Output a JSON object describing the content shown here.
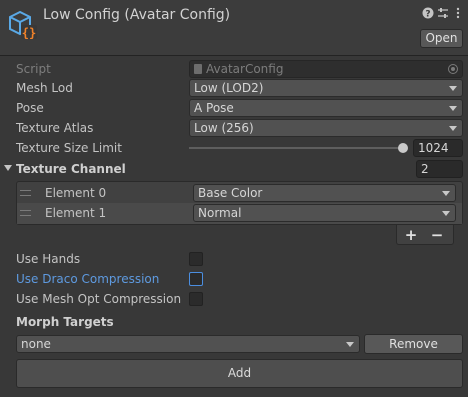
{
  "header": {
    "title": "Low Config (Avatar Config)",
    "help_icon": "help-icon",
    "settings_icon": "sliders-icon",
    "menu_icon": "kebab-menu-icon",
    "open_label": "Open"
  },
  "fields": {
    "script": {
      "label": "Script",
      "value": "AvatarConfig"
    },
    "mesh_lod": {
      "label": "Mesh Lod",
      "value": "Low (LOD2)"
    },
    "pose": {
      "label": "Pose",
      "value": "A Pose"
    },
    "texture_atlas": {
      "label": "Texture Atlas",
      "value": "Low (256)"
    },
    "texture_size_limit": {
      "label": "Texture Size Limit",
      "value": "1024"
    }
  },
  "texture_channel": {
    "label": "Texture Channel",
    "count": "2",
    "elements": [
      {
        "label": "Element 0",
        "value": "Base Color"
      },
      {
        "label": "Element 1",
        "value": "Normal"
      }
    ],
    "add_label": "+",
    "remove_label": "−"
  },
  "toggles": {
    "use_hands": {
      "label": "Use Hands",
      "checked": false
    },
    "use_draco": {
      "label": "Use Draco Compression",
      "checked": false
    },
    "use_mesh_opt": {
      "label": "Use Mesh Opt Compression",
      "checked": false
    }
  },
  "morph_targets": {
    "label": "Morph Targets",
    "selected": "none",
    "remove_label": "Remove",
    "add_label": "Add"
  },
  "colors": {
    "background": "#383838",
    "accent_blue": "#5e9ae0",
    "icon_blue": "#5aa9e6",
    "icon_orange": "#f0822a"
  }
}
